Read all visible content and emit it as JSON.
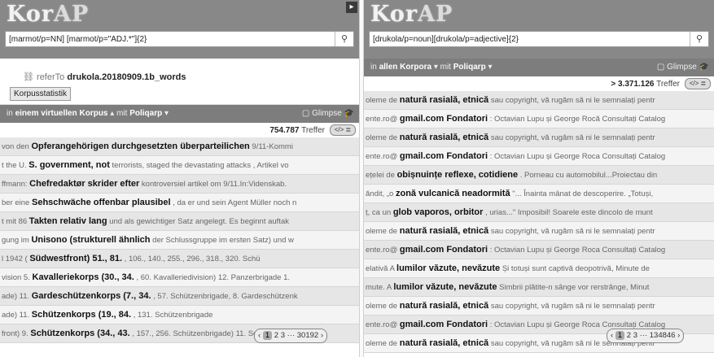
{
  "left": {
    "logo_main": "Kor",
    "logo_ap": "AP",
    "query": "[marmot/p=NN] [marmot/p=\"ADJ.*\"]{2}",
    "refer_prefix": "referTo",
    "refer_value": "drukola.20180909.1b_words",
    "korpusstatistik": "Korpusstatistik",
    "scope_prefix": "in",
    "scope_value": "einem virtuellen Korpus",
    "scope_mid": "mit",
    "scope_lang": "Poliqarp",
    "glimpse": "Glimpse",
    "hits": "754.787",
    "hits_label": "Treffer",
    "rows": [
      {
        "pre": "von den",
        "match": "Opferangehörigen durchgesetzten überparteilichen",
        "post": "9/11-Kommi"
      },
      {
        "pre": "t the U.",
        "match": "S. government, not",
        "post": "terrorists, staged the devastating attacks , Artikel vo"
      },
      {
        "pre": "ffmann:",
        "match": "Chefredaktør skrider efter",
        "post": "kontroversiel artikel om 9/11.In:Videnskab."
      },
      {
        "pre": "ber eine",
        "match": "Sehschwäche offenbar plausibel",
        "post": ", da er und sein Agent Müller noch n"
      },
      {
        "pre": "t mit 86",
        "match": "Takten relativ lang",
        "post": "und als gewichtiger Satz angelegt. Es beginnt auftak"
      },
      {
        "pre": "gung im",
        "match": "Unisono (strukturell ähnlich",
        "post": "der Schlussgruppe im ersten Satz) und w"
      },
      {
        "pre": "l 1942 (",
        "match": "Südwestfront) 51., 81.",
        "post": ", 106., 140., 255., 296., 318., 320. Schü"
      },
      {
        "pre": "vision 5.",
        "match": "Kavalleriekorps (30., 34.",
        "post": ", 60. Kavalleriedivision) 12. Panzerbrigade 1."
      },
      {
        "pre": "ade) 11.",
        "match": "Gardeschützenkorps (7., 34.",
        "post": ", 57. Schützenbrigade, 8. Gardeschützenk"
      },
      {
        "pre": "ade) 11.",
        "match": "Schützenkorps (19., 84.",
        "post": ", 131. Schützenbrigade"
      },
      {
        "pre": "front) 9.",
        "match": "Schützenkorps (34., 43.",
        "post": ", 157., 256. Schützenbrigade) 11. Schützenkor"
      }
    ],
    "pager": {
      "prev": "‹",
      "cur": "1",
      "p2": "2",
      "p3": "3",
      "dots": "···",
      "last": "30192",
      "next": "›"
    }
  },
  "right": {
    "logo_main": "Kor",
    "logo_ap": "AP",
    "query": "[drukola/p=noun][drukola/p=adjective]{2}",
    "scope_prefix": "in",
    "scope_value": "allen Korpora",
    "scope_mid": "mit",
    "scope_lang": "Poliqarp",
    "glimpse": "Glimpse",
    "hits": "> 3.371.126",
    "hits_label": "Treffer",
    "rows": [
      {
        "pre": "oleme de",
        "match": "natură rasială, etnică",
        "post": "sau copyright, vă rugăm să ni le semnalați pentr"
      },
      {
        "pre": "ente.ro@",
        "match": "gmail.com Fondatori",
        "post": ": Octavian Lupu și George Rocă Consultați Catalog"
      },
      {
        "pre": "oleme de",
        "match": "natură rasială, etnică",
        "post": "sau copyright, vă rugăm să ni le semnalați pentr"
      },
      {
        "pre": "ente.ro@",
        "match": "gmail.com Fondatori",
        "post": ": Octavian Lupu și George Roca Consultați Catalog"
      },
      {
        "pre": "ețelei de",
        "match": "obișnuințe reflexe, cotidiene",
        "post": ". Porneau cu automobilul...Proiectau din"
      },
      {
        "pre": "ăndit, „o",
        "match": "zonă vulcanică neadormită",
        "post": "\"... Înainta mânat de descoperire. „Totuși,"
      },
      {
        "pre": "ț, ca un",
        "match": "glob vaporos, orbitor",
        "post": ", urias...\" Imposibil! Soarele este dincolo de munt"
      },
      {
        "pre": "oleme de",
        "match": "natură rasială, etnică",
        "post": "sau copyright, vă rugăm să ni le semnalați pentr"
      },
      {
        "pre": "ente.ro@",
        "match": "gmail.com Fondatori",
        "post": ": Octavian Lupu și George Roca Consultați Catalog"
      },
      {
        "pre": "elativă A",
        "match": "lumilor văzute, nevăzute",
        "post": "Și totuși sunt captivă deopotrivă, Minute de"
      },
      {
        "pre": "mute. A",
        "match": "lumilor văzute, nevăzute",
        "post": "Simbrii plătite-n sânge vor rerstrânge, Minut"
      },
      {
        "pre": "oleme de",
        "match": "natură rasială, etnică",
        "post": "sau copyright, vă rugăm să ni le semnalați pentr"
      },
      {
        "pre": "ente.ro@",
        "match": "gmail.com Fondatori",
        "post": ": Octavian Lupu și George Roca Consultați Catalog"
      },
      {
        "pre": "oleme de",
        "match": "natură rasială, etnică",
        "post": "sau copyright, vă rugăm să ni le semnalați pentr"
      }
    ],
    "pager": {
      "prev": "‹",
      "cur": "1",
      "p2": "2",
      "p3": "3",
      "dots": "···",
      "last": "134846",
      "next": "›"
    }
  },
  "icons": {
    "search": "magnifier",
    "refer": "link-icon",
    "toggle": "code-list",
    "glimpse": "mortarboard",
    "corner": "collapse"
  }
}
